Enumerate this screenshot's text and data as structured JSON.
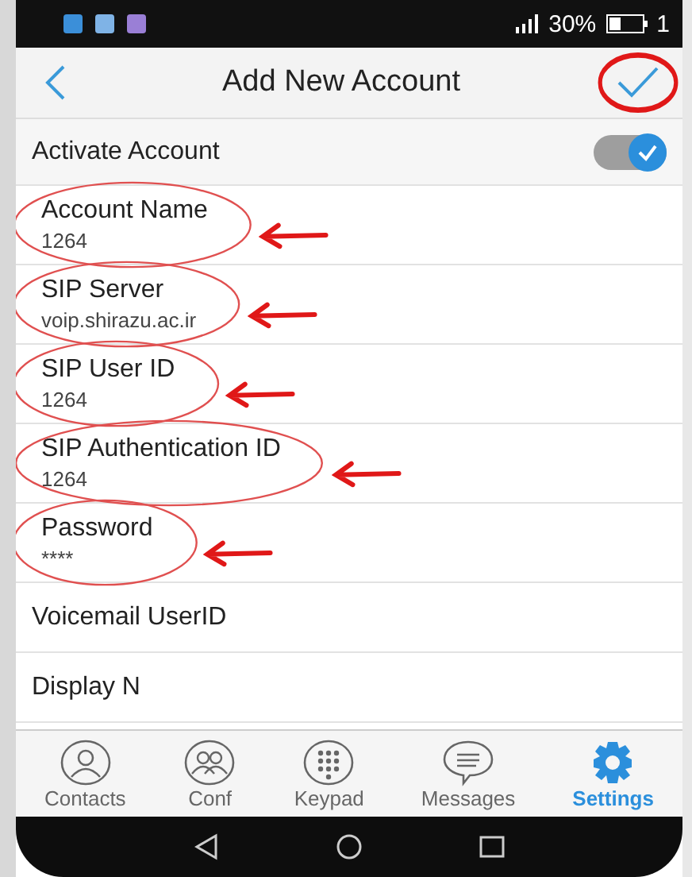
{
  "status_bar": {
    "battery": "30%",
    "time": "1"
  },
  "header": {
    "title": "Add New Account",
    "circled_confirm": true
  },
  "activate": {
    "label": "Activate Account",
    "on": true
  },
  "fields": [
    {
      "label": "Account Name",
      "value": "1264",
      "circled": true
    },
    {
      "label": "SIP Server",
      "value": "voip.shirazu.ac.ir",
      "circled": true
    },
    {
      "label": "SIP User ID",
      "value": "1264",
      "circled": true
    },
    {
      "label": "SIP Authentication ID",
      "value": "1264",
      "circled": true
    },
    {
      "label": "Password",
      "value": "****",
      "circled": true
    }
  ],
  "plain_rows": [
    "Voicemail UserID",
    "Display N"
  ],
  "tabs": [
    {
      "label": "Contacts",
      "kind": "contact",
      "selected": false
    },
    {
      "label": "Conf",
      "kind": "conf",
      "selected": false
    },
    {
      "label": "Keypad",
      "kind": "keypad",
      "selected": false
    },
    {
      "label": "Messages",
      "kind": "message",
      "selected": false
    },
    {
      "label": "Settings",
      "kind": "gear",
      "selected": true
    }
  ]
}
